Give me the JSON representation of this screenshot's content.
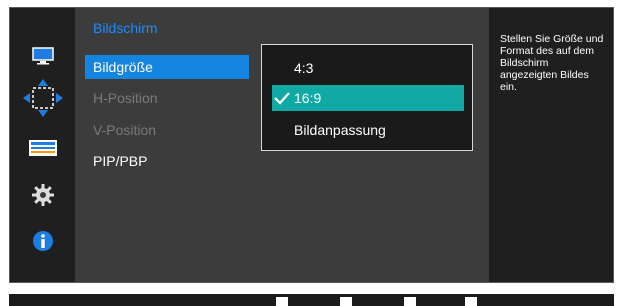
{
  "main": {
    "section_title": "Bildschirm",
    "menu_items": [
      {
        "label": "Bildgröße",
        "state": "active"
      },
      {
        "label": "H-Position",
        "state": "disabled"
      },
      {
        "label": "V-Position",
        "state": "disabled"
      },
      {
        "label": "PIP/PBP",
        "state": "normal"
      }
    ]
  },
  "submenu": {
    "options": [
      {
        "label": "4:3"
      },
      {
        "label": "16:9",
        "selected": true
      },
      {
        "label": "Bildanpassung"
      }
    ]
  },
  "info": {
    "text": "Stellen Sie Größe und Format des auf dem Bildschirm angezeigten Bildes ein."
  },
  "icons": [
    "monitor-icon",
    "position-icon",
    "pip-icon",
    "settings-gear-icon",
    "information-icon"
  ],
  "colors": {
    "accent_blue": "#1585e0",
    "title_blue": "#1a8cff",
    "selected_teal": "#10a9a3"
  }
}
